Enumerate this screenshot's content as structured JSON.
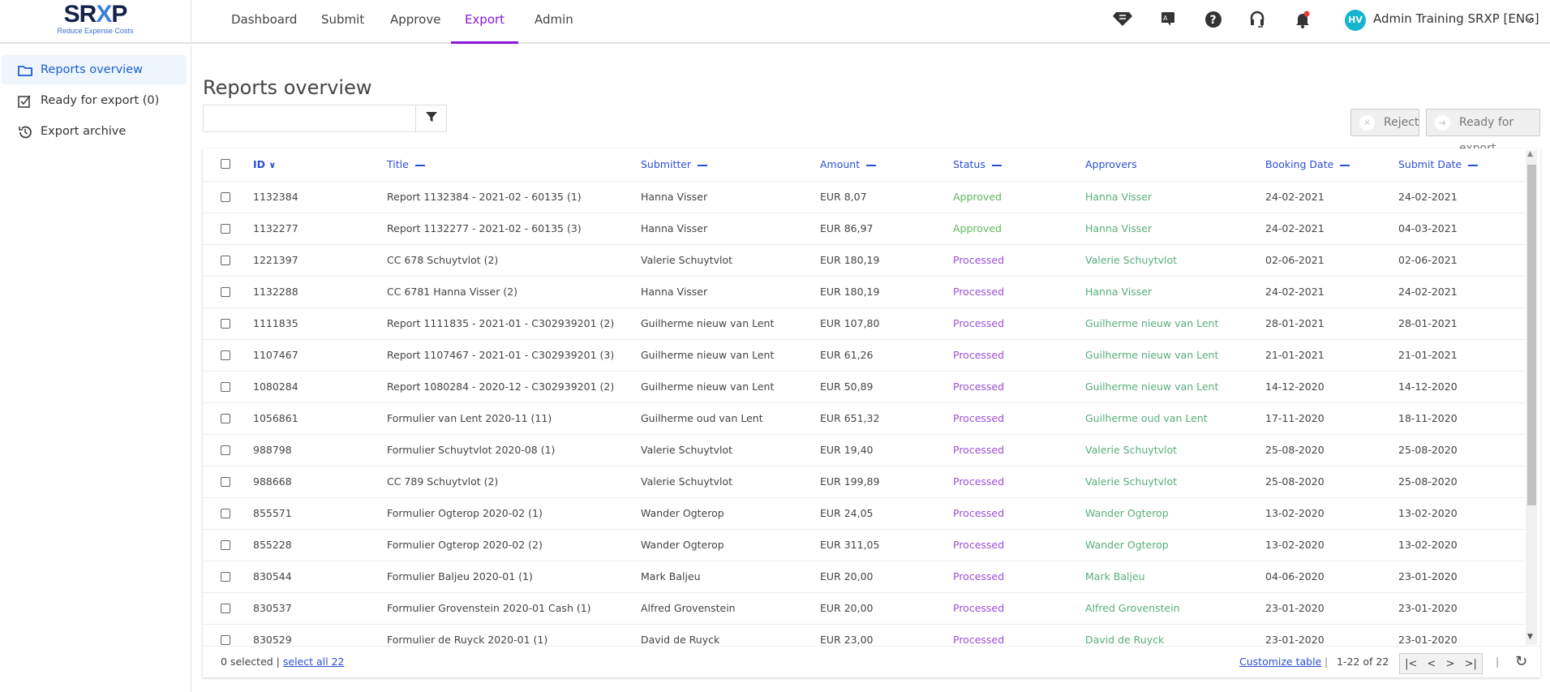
{
  "logo": {
    "name": "SRXP",
    "tagline": "Reduce Expense Costs"
  },
  "nav": [
    {
      "label": "Dashboard"
    },
    {
      "label": "Submit"
    },
    {
      "label": "Approve"
    },
    {
      "label": "Export",
      "active": true
    },
    {
      "label": "Admin"
    }
  ],
  "user": {
    "initials": "HV",
    "name": "Admin Training SRXP [ENG]"
  },
  "accent": "#8a16d8",
  "sidebar": [
    {
      "label": "Reports overview",
      "icon": "folder-icon"
    },
    {
      "label": "Ready for export (0)",
      "icon": "checkbox-icon"
    },
    {
      "label": "Export archive",
      "icon": "history-icon"
    }
  ],
  "page": {
    "title": "Reports overview",
    "search_value": "",
    "search_placeholder": ""
  },
  "actions": {
    "reject": "Reject",
    "ready": "Ready for export"
  },
  "columns": [
    "ID",
    "Title",
    "Submitter",
    "Amount",
    "Status",
    "Approvers",
    "Booking Date",
    "Submit Date"
  ],
  "rows": [
    [
      "1132384",
      "Report 1132384 - 2021-02 - 60135 (1)",
      "Hanna Visser",
      "EUR 8,07",
      "Approved",
      "Hanna Visser",
      "24-02-2021",
      "24-02-2021"
    ],
    [
      "1132277",
      "Report 1132277 - 2021-02 - 60135 (3)",
      "Hanna Visser",
      "EUR 86,97",
      "Approved",
      "Hanna Visser",
      "24-02-2021",
      "04-03-2021"
    ],
    [
      "1221397",
      "CC 678 Schuytvlot (2)",
      "Valerie Schuytvlot",
      "EUR 180,19",
      "Processed",
      "Valerie Schuytvlot",
      "02-06-2021",
      "02-06-2021"
    ],
    [
      "1132288",
      "CC 6781 Hanna Visser (2)",
      "Hanna Visser",
      "EUR 180,19",
      "Processed",
      "Hanna Visser",
      "24-02-2021",
      "24-02-2021"
    ],
    [
      "1111835",
      "Report 1111835 - 2021-01 - C302939201 (2)",
      "Guilherme nieuw van Lent",
      "EUR 107,80",
      "Processed",
      "Guilherme nieuw van Lent",
      "28-01-2021",
      "28-01-2021"
    ],
    [
      "1107467",
      "Report 1107467 - 2021-01 - C302939201 (3)",
      "Guilherme nieuw van Lent",
      "EUR 61,26",
      "Processed",
      "Guilherme nieuw van Lent",
      "21-01-2021",
      "21-01-2021"
    ],
    [
      "1080284",
      "Report 1080284 - 2020-12 - C302939201 (2)",
      "Guilherme nieuw van Lent",
      "EUR 50,89",
      "Processed",
      "Guilherme nieuw van Lent",
      "14-12-2020",
      "14-12-2020"
    ],
    [
      "1056861",
      "Formulier van Lent 2020-11 (11)",
      "Guilherme oud van Lent",
      "EUR 651,32",
      "Processed",
      "Guilherme oud van Lent",
      "17-11-2020",
      "18-11-2020"
    ],
    [
      "988798",
      "Formulier Schuytvlot 2020-08 (1)",
      "Valerie Schuytvlot",
      "EUR 19,40",
      "Processed",
      "Valerie Schuytvlot",
      "25-08-2020",
      "25-08-2020"
    ],
    [
      "988668",
      "CC 789 Schuytvlot (2)",
      "Valerie Schuytvlot",
      "EUR 199,89",
      "Processed",
      "Valerie Schuytvlot",
      "25-08-2020",
      "25-08-2020"
    ],
    [
      "855571",
      "Formulier Ogterop 2020-02 (1)",
      "Wander Ogterop",
      "EUR 24,05",
      "Processed",
      "Wander Ogterop",
      "13-02-2020",
      "13-02-2020"
    ],
    [
      "855228",
      "Formulier Ogterop 2020-02 (2)",
      "Wander Ogterop",
      "EUR 311,05",
      "Processed",
      "Wander Ogterop",
      "13-02-2020",
      "13-02-2020"
    ],
    [
      "830544",
      "Formulier Baljeu 2020-01 (1)",
      "Mark Baljeu",
      "EUR 20,00",
      "Processed",
      "Mark Baljeu",
      "04-06-2020",
      "23-01-2020"
    ],
    [
      "830537",
      "Formulier Grovenstein 2020-01 Cash (1)",
      "Alfred Grovenstein",
      "EUR 20,00",
      "Processed",
      "Alfred Grovenstein",
      "23-01-2020",
      "23-01-2020"
    ],
    [
      "830529",
      "Formulier de Ruyck 2020-01 (1)",
      "David de Ruyck",
      "EUR 23,00",
      "Processed",
      "David de Ruyck",
      "23-01-2020",
      "23-01-2020"
    ]
  ],
  "footer": {
    "selected": "0 selected",
    "select_all": "select all 22",
    "customize": "Customize table",
    "range": "1-22 of 22"
  }
}
